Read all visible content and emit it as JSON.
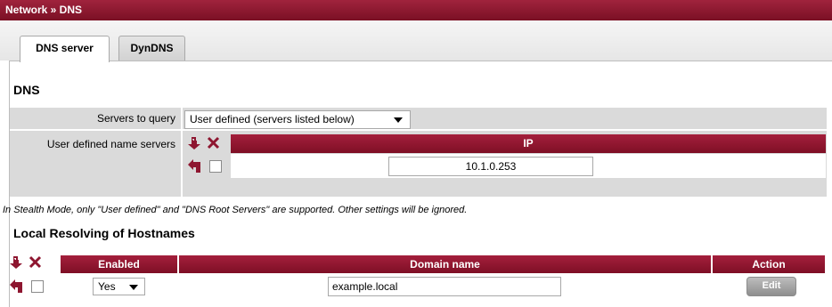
{
  "breadcrumb": "Network » DNS",
  "tabs": [
    {
      "label": "DNS server",
      "active": true
    },
    {
      "label": "DynDNS",
      "active": false
    }
  ],
  "dns_section": {
    "title": "DNS",
    "servers_to_query_label": "Servers to query",
    "servers_to_query_value": "User defined (servers listed below)",
    "user_defined_label": "User defined name servers",
    "ip_header": "IP",
    "ip_rows": [
      {
        "ip": "10.1.0.253",
        "checked": false
      }
    ],
    "stealth_note": "In Stealth Mode, only \"User defined\" and \"DNS Root Servers\" are supported. Other settings will be ignored."
  },
  "local_section": {
    "title": "Local Resolving of Hostnames",
    "columns": {
      "enabled": "Enabled",
      "domain": "Domain name",
      "action": "Action"
    },
    "rows": [
      {
        "enabled": "Yes",
        "domain": "example.local",
        "action": "Edit",
        "checked": false
      }
    ]
  },
  "icons": {
    "insert_below": "insert-row-icon",
    "delete": "delete-rows-icon",
    "insert_here": "insert-here-arrow-icon"
  },
  "colors": {
    "accent": "#8e1630",
    "header_gradient_top": "#a41f3c",
    "panel_gray": "#dadada"
  }
}
